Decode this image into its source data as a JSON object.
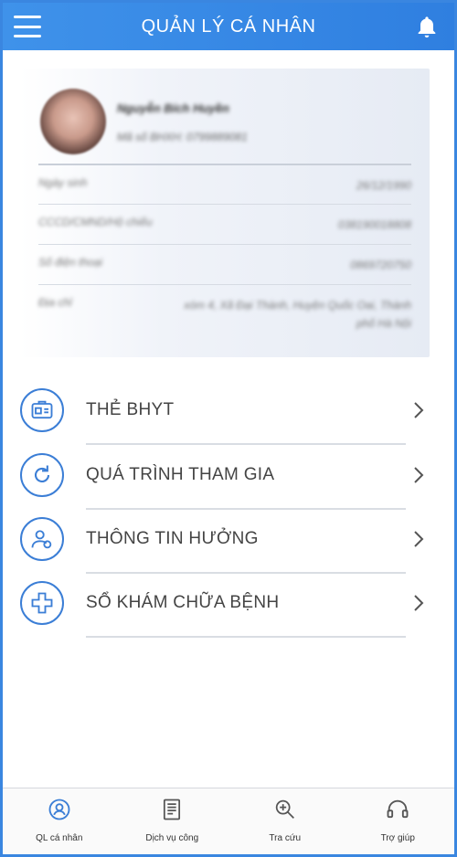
{
  "header": {
    "title": "QUẢN LÝ CÁ NHÂN",
    "menu_icon": "hamburger-menu-icon",
    "bell_icon": "bell-icon"
  },
  "profile": {
    "name": "Nguyễn Bích Huyền",
    "subline": "Mã số BHXH: 0799889081",
    "rows": [
      {
        "label": "Ngày sinh",
        "value": "26/12/1990"
      },
      {
        "label": "CCCD/CMND/Hộ chiếu",
        "value": "038190018808"
      },
      {
        "label": "Số điện thoại",
        "value": "0869720750"
      },
      {
        "label": "Địa chỉ",
        "value": "xóm 4, Xã Đại Thành, Huyện Quốc Oai, Thành phố Hà Nội"
      }
    ]
  },
  "menu": [
    {
      "label": "THẺ BHYT",
      "icon": "insurance-card-icon"
    },
    {
      "label": "QUÁ TRÌNH THAM GIA",
      "icon": "refresh-history-icon"
    },
    {
      "label": "THÔNG TIN HƯỞNG",
      "icon": "user-benefit-icon"
    },
    {
      "label": "SỔ KHÁM CHỮA BỆNH",
      "icon": "medical-cross-icon"
    }
  ],
  "tabbar": [
    {
      "label": "QL cá nhân",
      "icon": "personal-management-icon",
      "active": true
    },
    {
      "label": "Dịch vụ công",
      "icon": "public-service-icon",
      "active": false
    },
    {
      "label": "Tra cứu",
      "icon": "lookup-search-icon",
      "active": false
    },
    {
      "label": "Trợ giúp",
      "icon": "headset-help-icon",
      "active": false
    }
  ],
  "colors": {
    "accent": "#2f7fe0",
    "icon_stroke": "#3b7ed6",
    "text": "#444444"
  }
}
